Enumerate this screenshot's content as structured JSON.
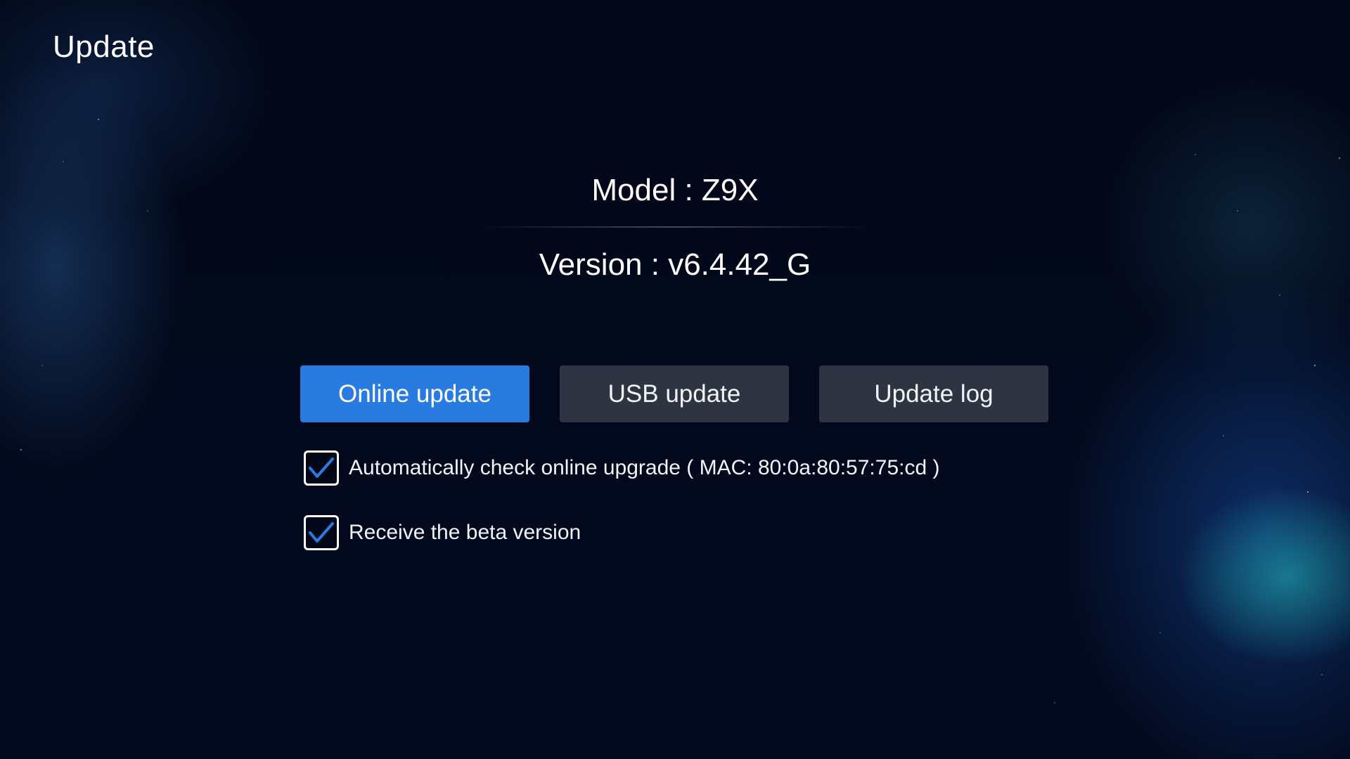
{
  "page": {
    "title": "Update"
  },
  "device": {
    "model": "Model : Z9X",
    "version": "Version : v6.4.42_G"
  },
  "buttons": {
    "online_update": "Online update",
    "usb_update": "USB update",
    "update_log": "Update log"
  },
  "options": [
    {
      "label": "Automatically check online upgrade ( MAC: 80:0a:80:57:75:cd )",
      "checked": true,
      "icon": "check-icon"
    },
    {
      "label": "Receive the beta version",
      "checked": true,
      "icon": "check-icon"
    }
  ],
  "colors": {
    "background": "#030a1f",
    "accent": "#2a7be0",
    "button": "#2e3442",
    "checkmark": "#2a7be0"
  }
}
